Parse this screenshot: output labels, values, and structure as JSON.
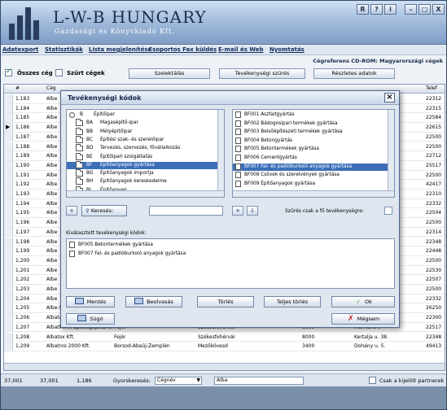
{
  "app": {
    "title": "L-W-B HUNGARY",
    "subtitle": "Gazdasági és Könyvkiadó Kft.",
    "window_buttons": [
      "R",
      "?",
      "i",
      "–",
      "□",
      "X"
    ]
  },
  "menu": [
    "Adatexport",
    "Statisztikák",
    "Lista megjelenítése",
    "Csoportos Fax küldés",
    "E-mail és Web",
    "Nyomtatás"
  ],
  "cdrom_label": "Cégreferens CD-ROM: Magyarországi cégek",
  "filters": {
    "all_label": "Összes cég",
    "filtered_label": "Szűrt cégek",
    "buttons": [
      "Szelektálás",
      "Tevékenységi szűrés",
      "Részletes adatok"
    ]
  },
  "grid": {
    "headers": [
      "#",
      "Cég",
      "Telef"
    ],
    "top_rows": [
      {
        "n": "1,183",
        "c": "Albe",
        "t": "22312"
      },
      {
        "n": "1,184",
        "c": "Albe",
        "t": "22315"
      },
      {
        "n": "1,185",
        "c": "Albe",
        "t": "22584"
      },
      {
        "n": "1,186",
        "c": "Albe",
        "t": "22615"
      },
      {
        "n": "1,187",
        "c": "Albe",
        "t": "22500"
      },
      {
        "n": "1,188",
        "c": "Albe",
        "t": "22500"
      },
      {
        "n": "1,189",
        "c": "Albe",
        "t": "22712"
      },
      {
        "n": "1,190",
        "c": "Albe",
        "t": "25517"
      },
      {
        "n": "1,191",
        "c": "Albe",
        "t": "22500"
      },
      {
        "n": "1,192",
        "c": "Albe",
        "t": "42417"
      },
      {
        "n": "1,193",
        "c": "Albe",
        "t": "22310"
      },
      {
        "n": "1,194",
        "c": "Albe",
        "t": "22332"
      },
      {
        "n": "1,195",
        "c": "Albe",
        "t": "22504"
      },
      {
        "n": "1,196",
        "c": "Albe",
        "t": "22500"
      },
      {
        "n": "1,197",
        "c": "Albe",
        "t": "22314"
      },
      {
        "n": "1,198",
        "c": "Albe",
        "t": "22348"
      },
      {
        "n": "1,199",
        "c": "Albe",
        "t": "22448"
      },
      {
        "n": "1,200",
        "c": "Albe",
        "t": "22500"
      },
      {
        "n": "1,201",
        "c": "Albe",
        "t": "22530"
      },
      {
        "n": "1,202",
        "c": "Albe",
        "t": "22507"
      },
      {
        "n": "1,203",
        "c": "Albe",
        "t": "22500"
      },
      {
        "n": "1,204",
        "c": "Albe",
        "t": "22332"
      }
    ],
    "full_rows": [
      {
        "n": "1,205",
        "c": "Albe-Staller Kft.",
        "m": "Pest",
        "v": "Budapest",
        "z": "1107",
        "a": "Mázsa tér 3-5.",
        "t": "26250"
      },
      {
        "n": "1,206",
        "c": "Albatax 96 Kft.",
        "m": "Fejér",
        "v": "Székesfehérvár",
        "z": "8000",
        "a": "Liget sor 8.",
        "t": "22300"
      },
      {
        "n": "1,207",
        "c": "Albatherm Épületgépész Kft.",
        "m": "Fejér",
        "v": "Székesfehérvár",
        "z": "8000",
        "a": "Móri út 34.",
        "t": "22517"
      },
      {
        "n": "1,208",
        "c": "Albatox Kft.",
        "m": "Fejér",
        "v": "Székesfehérvár",
        "z": "8000",
        "a": "Kertalja u. 38.",
        "t": "22348"
      },
      {
        "n": "1,209",
        "c": "Albatros 2000 Kft.",
        "m": "Borsod-Abaúj-Zemplén",
        "v": "Mezőkövesd",
        "z": "3400",
        "a": "Dohány u. 5.",
        "t": "49413"
      }
    ]
  },
  "statusbar": {
    "count1": "37,001",
    "count2": "37,001",
    "count3": "1,186",
    "quick_search_label": "Gyorskeresés:",
    "quick_search_field": "Cégnév",
    "quick_search_value": "Alba",
    "only_selected_label": "Csak a kijelölt partnerek"
  },
  "dialog": {
    "title": "Tevékenységi kódok",
    "left_list": [
      {
        "code": "B",
        "label": "Építőipar",
        "icon": "radio"
      },
      {
        "code": "BA",
        "label": "Magasépítő-ipar",
        "icon": "folder"
      },
      {
        "code": "BB",
        "label": "Mélyépítőipar",
        "icon": "folder"
      },
      {
        "code": "BC",
        "label": "Építési szak- és szerelőipar",
        "icon": "folder"
      },
      {
        "code": "BD",
        "label": "Tervezés, szervezés, fővállalkozás",
        "icon": "folder"
      },
      {
        "code": "BE",
        "label": "Építőipari szolgáltatás",
        "icon": "folder"
      },
      {
        "code": "BF",
        "label": "Építőanyagok gyártása",
        "icon": "folder"
      },
      {
        "code": "BG",
        "label": "Építőanyagok importja",
        "icon": "folder"
      },
      {
        "code": "BH",
        "label": "Építőanyagok kereskedelme",
        "icon": "folder"
      },
      {
        "code": "BI",
        "label": "Építőanyag ...",
        "icon": "folder"
      }
    ],
    "left_selected_index": 6,
    "right_list": [
      "BF001 Aszfaltgyártás",
      "BF002 Bádogosipari termékek gyártása",
      "BF003 Belsőépítészeti termékek gyártása",
      "BF004 Betongyártás",
      "BF005 Betontermékek gyártása",
      "BF006 Cementgyártás",
      "BF007 Fal- és padlóburkoló anyagok gyártása",
      "BF008 Csövek és szerelvények gyártása",
      "BF009 Építőanyagok gyártása"
    ],
    "right_selected_index": 6,
    "search_button": "Keresés:",
    "search_value": "",
    "main_only_label": "Szűrés csak a fő tevékenységre:",
    "selected_caption": "Kiválasztott tevékenységi kódok:",
    "selected_list": [
      "BF005 Betontermékek gyártása",
      "BF007 Fal- és padlóburkoló anyagok gyártása"
    ],
    "buttons": {
      "save": "Mentés",
      "load": "Beolvasás",
      "delete": "Törlés",
      "delete_all": "Teljes törlés",
      "ok": "Ok",
      "help": "Súgó",
      "cancel": "Mégsem"
    }
  }
}
